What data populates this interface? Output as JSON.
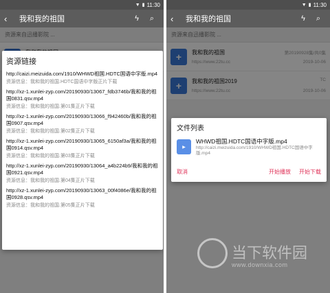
{
  "status": {
    "time": "11:30"
  },
  "toolbar": {
    "title": "我和我的祖国"
  },
  "source_label": "资源来自迅播影院 ...",
  "left_list_partial": "我和我的祖国",
  "resources_dialog": {
    "title": "资源链接",
    "entries": [
      {
        "link": "http://caizi.meizuida.com/1910/WHWD祖国.HDTC国语中字版.mp4",
        "info": "资源信息：我和我的祖国.HDTC国语中字版正片下载"
      },
      {
        "link": "http://xz-1.xunlei-zyp.com/20190930/13067_fdb3746b/我和我的祖国0831.qsv.mp4",
        "info": "资源信息：我和我的祖国.第01集正片下载"
      },
      {
        "link": "http://xz-1.xunlei-zyp.com/20190930/13066_f942460b/我和我的祖国0907.qsv.mp4",
        "info": "资源信息：我和我的祖国.第02集正片下载"
      },
      {
        "link": "http://xz-1.xunlei-zyp.com/20190930/13065_6150af3a/我和我的祖国0914.qsv.mp4",
        "info": "资源信息：我和我的祖国.第03集正片下载"
      },
      {
        "link": "http://xz-1.xunlei-zyp.com/20190930/13064_a4b224b9/我和我的祖国0921.qsv.mp4",
        "info": "资源信息：我和我的祖国.第04集正片下载"
      },
      {
        "link": "http://xz-1.xunlei-zyp.com/20190930/13063_00f4086e/我和我的祖国0928.qsv.mp4",
        "info": "资源信息：我和我的祖国.第05集正片下载"
      }
    ]
  },
  "right_list": [
    {
      "name": "我和我的祖国",
      "url": "https://www.22tu.cc",
      "tag": "第20190928集/共0集",
      "date": "2019-10-06"
    },
    {
      "name": "我和我的祖国2019",
      "url": "https://www.22tu.cc",
      "tag": "TC",
      "date": "2019-10-06"
    }
  ],
  "file_dialog": {
    "title": "文件列表",
    "file_name": "WHWD祖国.HDTC国语中字版.mp4",
    "file_url": "http://caizi.meizuida.com/1910/WHWD祖国.HDTC国语中字版.mp4",
    "cancel": "取消",
    "play": "开始播放",
    "download": "开始下载"
  },
  "watermark": {
    "text": "当下软件园",
    "url": "www.downxia.com"
  }
}
